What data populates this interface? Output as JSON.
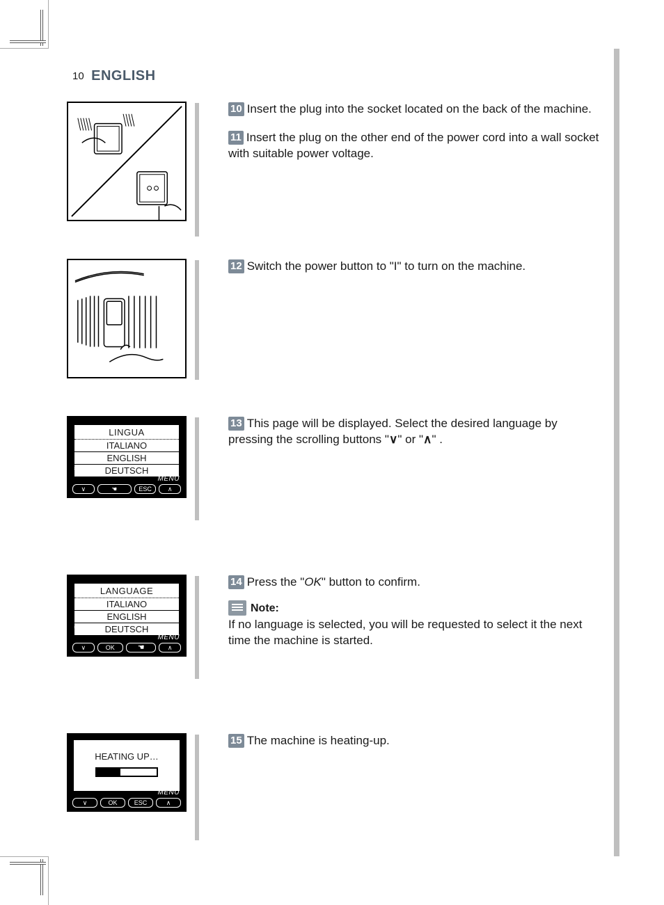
{
  "header": {
    "page_number": "10",
    "language": "ENGLISH"
  },
  "steps": {
    "s10": {
      "num": "10",
      "text": "Insert the plug into the socket located on the back of the machine."
    },
    "s11": {
      "num": "11",
      "text": "Insert the plug on the other end of the power cord into a wall socket with suitable power voltage."
    },
    "s12": {
      "num": "12",
      "text": "Switch the power button to \"I\" to turn on the machine."
    },
    "s13": {
      "num": "13",
      "text_a": "This page will be displayed. Select the desired language by pressing the scrolling buttons \"",
      "text_b": "\" or \"",
      "text_c": "\" ."
    },
    "s14": {
      "num": "14",
      "text_a": "Press the \"",
      "ok": "OK",
      "text_b": "\" button to confirm."
    },
    "s15": {
      "num": "15",
      "text": "The machine is heating-up."
    }
  },
  "note": {
    "label": "Note:",
    "body": "If no language is selected, you will be requested to select it the next time the machine is started."
  },
  "lcd1": {
    "title": "LINGUA",
    "rows": [
      "ITALIANO",
      "ENGLISH",
      "DEUTSCH"
    ],
    "menu": "MENU",
    "btn_down": "∨",
    "btn_esc": "ESC",
    "btn_up": "∧"
  },
  "lcd2": {
    "title": "LANGUAGE",
    "rows": [
      "ITALIANO",
      "ENGLISH",
      "DEUTSCH"
    ],
    "menu": "MENU",
    "btn_down": "∨",
    "btn_ok": "OK",
    "btn_up": "∧"
  },
  "lcd3": {
    "title": "HEATING UP…",
    "menu": "MENU",
    "btn_down": "∨",
    "btn_ok": "OK",
    "btn_esc": "ESC",
    "btn_up": "∧"
  },
  "icons": {
    "arrow_down": "∨",
    "arrow_up": "∧"
  }
}
